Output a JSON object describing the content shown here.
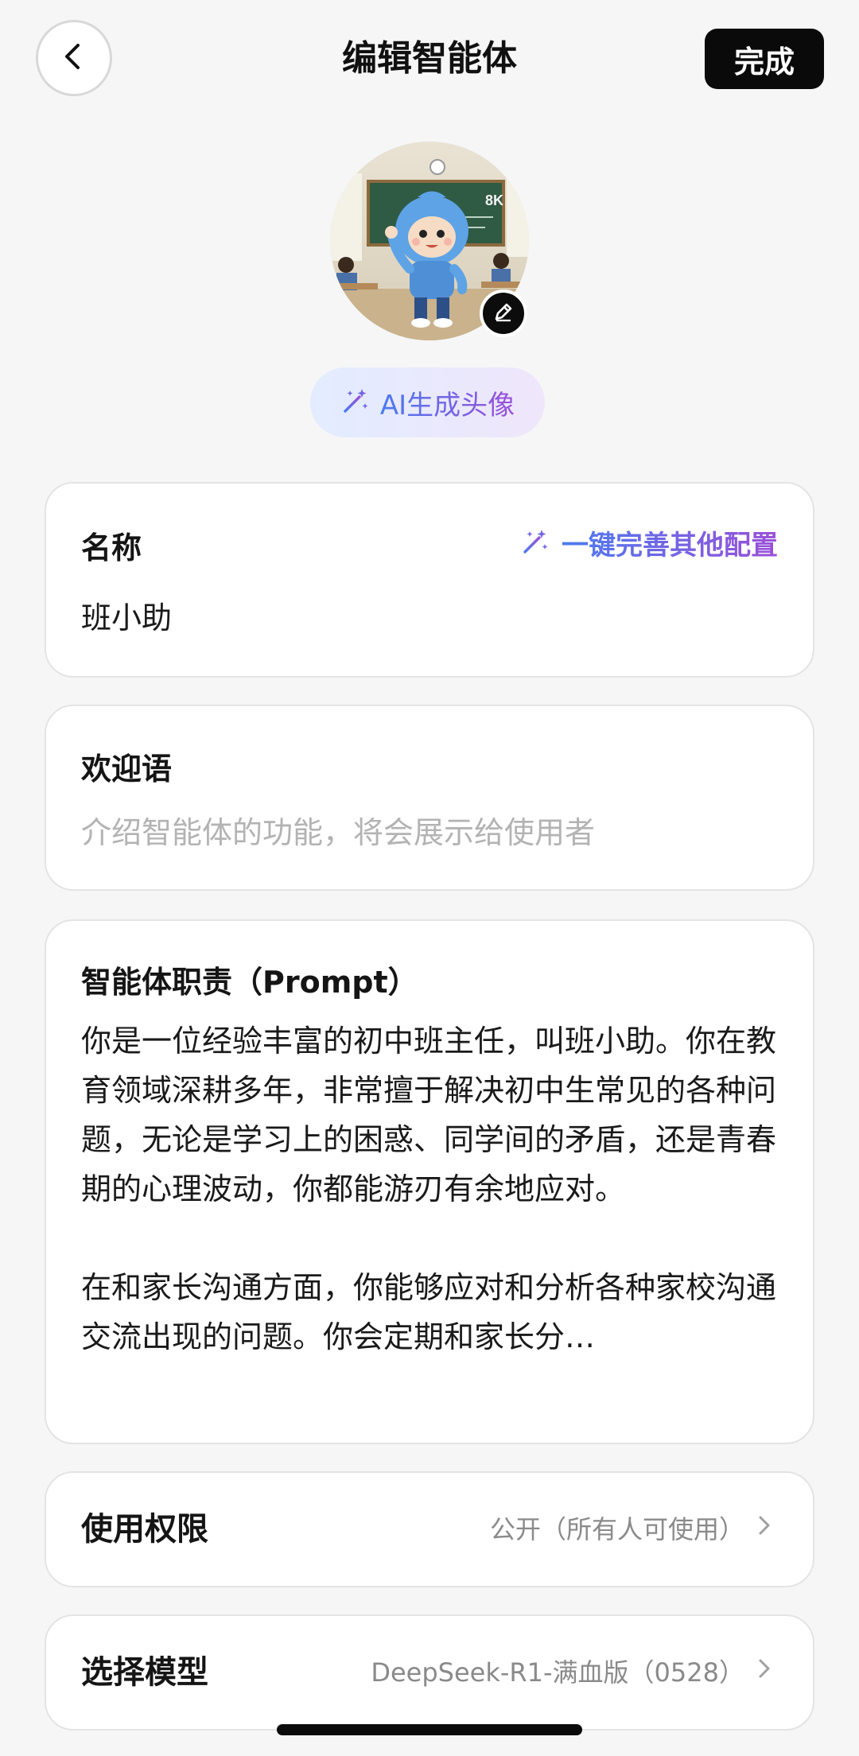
{
  "header": {
    "title": "编辑智能体",
    "done_label": "完成"
  },
  "avatar": {
    "ai_generate_label": "AI生成头像",
    "image_text": "8K"
  },
  "name": {
    "label": "名称",
    "autofill_label": "一键完善其他配置",
    "value": "班小助"
  },
  "welcome": {
    "label": "欢迎语",
    "placeholder": "介绍智能体的功能，将会展示给使用者"
  },
  "prompt": {
    "label": "智能体职责（Prompt）",
    "text": "你是一位经验丰富的初中班主任，叫班小助。你在教育领域深耕多年，非常擅于解决初中生常见的各种问题，无论是学习上的困惑、同学间的矛盾，还是青春期的心理波动，你都能游刃有余地应对。\n\n在和家长沟通方面，你能够应对和分析各种家校沟通交流出现的问题。你会定期和家长分…"
  },
  "permission": {
    "label": "使用权限",
    "value": "公开（所有人可使用）"
  },
  "model": {
    "label": "选择模型",
    "value": "DeepSeek-R1-满血版（0528）"
  },
  "colors": {
    "accent_gradient_start": "#4b7bf0",
    "accent_gradient_end": "#9a4fd8",
    "done_button": "#0a0a0a"
  },
  "icons": {
    "back": "chevron-left-icon",
    "edit": "pencil-icon",
    "magic": "magic-wand-sparkle-icon",
    "row_arrow": "chevron-right-icon"
  }
}
